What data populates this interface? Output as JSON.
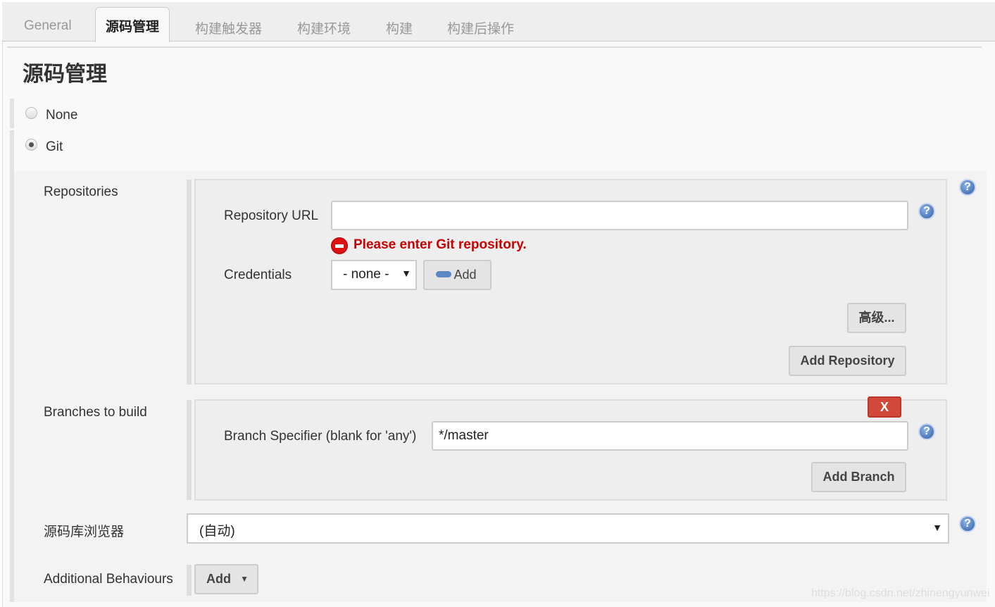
{
  "tabs": [
    {
      "label": "General"
    },
    {
      "label": "源码管理"
    },
    {
      "label": "构建触发器"
    },
    {
      "label": "构建环境"
    },
    {
      "label": "构建"
    },
    {
      "label": "构建后操作"
    }
  ],
  "page_title": "源码管理",
  "scm": {
    "options": [
      {
        "label": "None",
        "selected": false
      },
      {
        "label": "Git",
        "selected": true
      }
    ]
  },
  "repositories": {
    "label": "Repositories",
    "url_label": "Repository URL",
    "url_value": "",
    "error": "Please enter Git repository.",
    "credentials_label": "Credentials",
    "credentials_value": "- none -",
    "add_label": "Add",
    "advanced_label": "高级...",
    "add_repository_label": "Add Repository"
  },
  "branches": {
    "label": "Branches to build",
    "delete_label": "X",
    "specifier_label": "Branch Specifier (blank for 'any')",
    "specifier_value": "*/master",
    "add_branch_label": "Add Branch"
  },
  "browser": {
    "label": "源码库浏览器",
    "value": "(自动)"
  },
  "behaviours": {
    "label": "Additional Behaviours",
    "add_label": "Add"
  },
  "watermark": "https://blog.csdn.net/zhinengyunwei",
  "colors": {
    "error": "#cc0000",
    "delete_button": "#d24939",
    "help": "#2f5fa8"
  }
}
